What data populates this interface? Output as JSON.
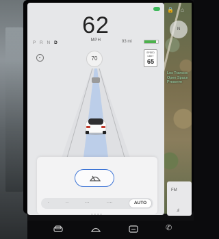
{
  "speedometer": {
    "speed": "62",
    "unit": "MPH"
  },
  "gear_selector": {
    "gears": [
      "P",
      "R",
      "N",
      "D"
    ],
    "active": "D"
  },
  "battery": {
    "range": "93 mi",
    "level_percent": 85,
    "color": "#4bb24b"
  },
  "set_speed": {
    "value": "70"
  },
  "speed_limit_sign": {
    "label": "SPEED LIMIT",
    "value": "65"
  },
  "wiper_control": {
    "icon": "wiper-icon",
    "accent_color": "#3d74d6",
    "speeds": [
      ".",
      "..",
      "...",
      "...."
    ],
    "auto_label": "AUTO"
  },
  "map": {
    "place_label": "Los Trancos Open Space Preserve"
  },
  "media_card": {
    "label": "FM"
  },
  "dock": {
    "icons": [
      "car-icon",
      "defrost-icon",
      "media-icon",
      "phone-icon"
    ]
  }
}
